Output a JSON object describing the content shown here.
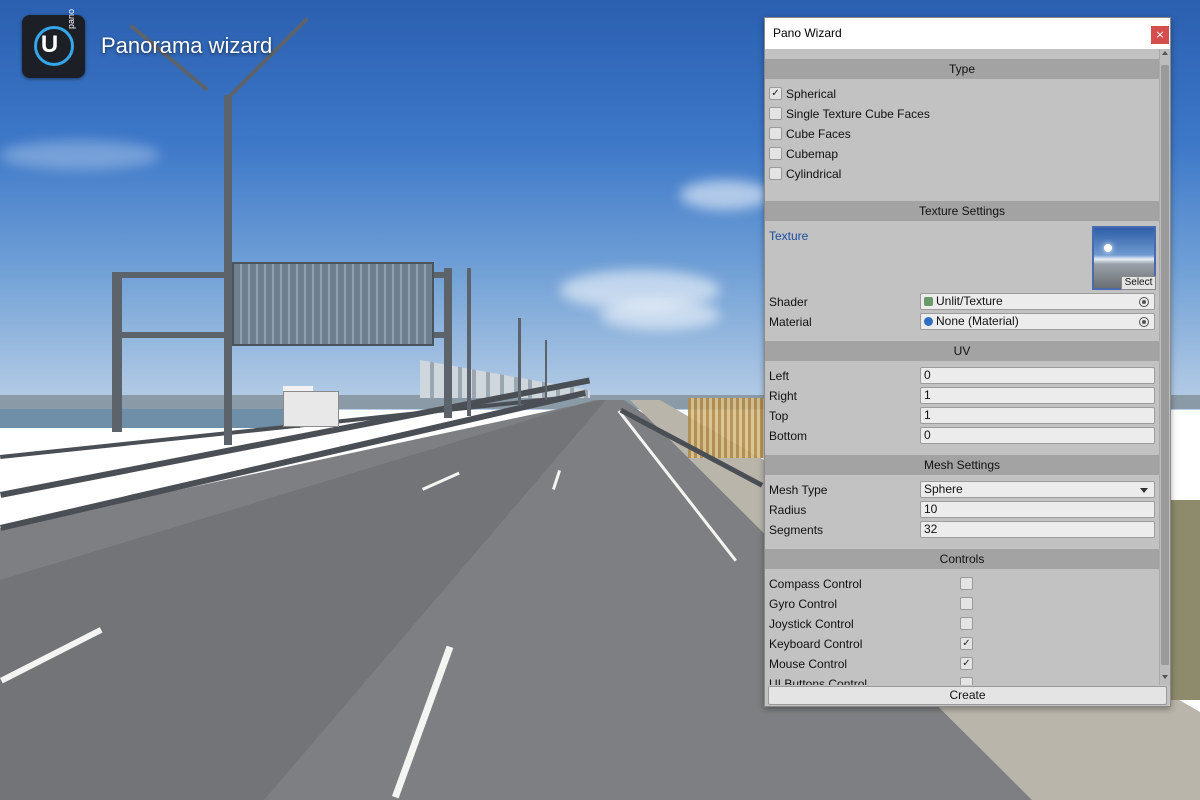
{
  "app": {
    "title": "Panorama wizard",
    "logo_letter": "U",
    "logo_sub": "pano"
  },
  "window": {
    "title": "Pano Wizard",
    "close_label": "×"
  },
  "type_section": {
    "header": "Type",
    "options": [
      {
        "label": "Spherical",
        "checked": true
      },
      {
        "label": "Single Texture Cube Faces",
        "checked": false
      },
      {
        "label": "Cube Faces",
        "checked": false
      },
      {
        "label": "Cubemap",
        "checked": false
      },
      {
        "label": "Cylindrical",
        "checked": false
      }
    ]
  },
  "texture_settings": {
    "header": "Texture Settings",
    "texture_label": "Texture",
    "select_label": "Select",
    "shader_label": "Shader",
    "shader_value": "Unlit/Texture",
    "material_label": "Material",
    "material_value": "None (Material)"
  },
  "uv": {
    "header": "UV",
    "fields": [
      {
        "label": "Left",
        "value": "0"
      },
      {
        "label": "Right",
        "value": "1"
      },
      {
        "label": "Top",
        "value": "1"
      },
      {
        "label": "Bottom",
        "value": "0"
      }
    ]
  },
  "mesh_settings": {
    "header": "Mesh Settings",
    "mesh_type_label": "Mesh Type",
    "mesh_type_value": "Sphere",
    "radius_label": "Radius",
    "radius_value": "10",
    "segments_label": "Segments",
    "segments_value": "32"
  },
  "controls": {
    "header": "Controls",
    "items": [
      {
        "label": "Compass Control",
        "checked": false
      },
      {
        "label": "Gyro Control",
        "checked": false
      },
      {
        "label": "Joystick Control",
        "checked": false
      },
      {
        "label": "Keyboard Control",
        "checked": true
      },
      {
        "label": "Mouse Control",
        "checked": true
      },
      {
        "label": "UI Buttons Control",
        "checked": false
      }
    ]
  },
  "footer": {
    "create_label": "Create"
  },
  "colors": {
    "accent_link": "#1a4ea0",
    "close_button": "#d44e4e",
    "section_header": "#a3a3a3",
    "panel_bg": "#c2c2c2",
    "logo_ring": "#34a6ea"
  },
  "check_glyph": "✓"
}
